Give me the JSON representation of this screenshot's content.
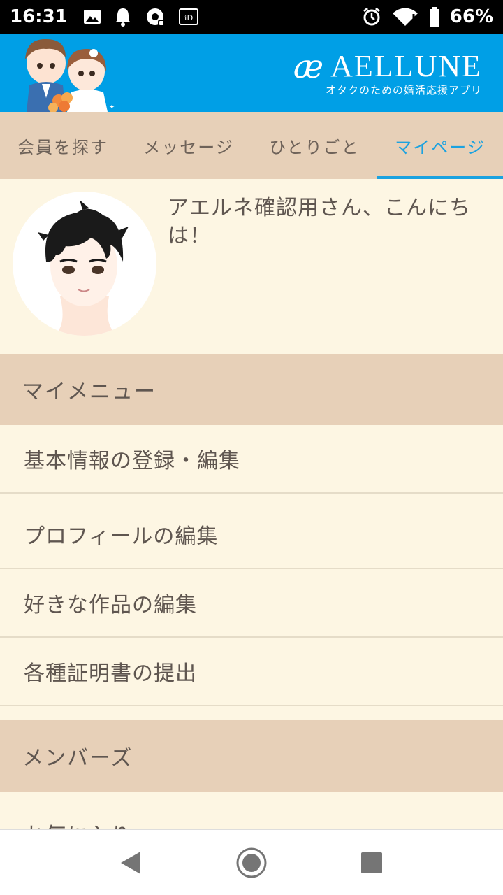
{
  "status_bar": {
    "time": "16:31",
    "battery": "66%",
    "left_icons": [
      "gallery-icon",
      "notification-bell-icon",
      "settings-app-icon",
      "id-card-icon"
    ],
    "right_icons": [
      "alarm-icon",
      "wifi-icon",
      "battery-icon"
    ]
  },
  "header": {
    "logo_mark": "æ",
    "logo_name": "AELLUNE",
    "tagline": "オタクのための婚活応援アプリ",
    "accent_color": "#009fe6"
  },
  "tabs": [
    {
      "label": "会員を探す",
      "active": false
    },
    {
      "label": "メッセージ",
      "active": false
    },
    {
      "label": "ひとりごと",
      "active": false
    },
    {
      "label": "マイページ",
      "active": true
    }
  ],
  "profile": {
    "greeting": "アエルネ確認用さん、こんにちは！"
  },
  "sections": {
    "my_menu": {
      "title": "マイメニュー",
      "items": [
        "基本情報の登録・編集",
        "プロフィールの編集",
        "好きな作品の編集",
        "各種証明書の提出"
      ]
    },
    "members": {
      "title": "メンバーズ",
      "items": [
        "お気に入り"
      ]
    }
  },
  "nav_bar": {
    "buttons": [
      "back-icon",
      "home-icon",
      "recents-icon"
    ]
  }
}
